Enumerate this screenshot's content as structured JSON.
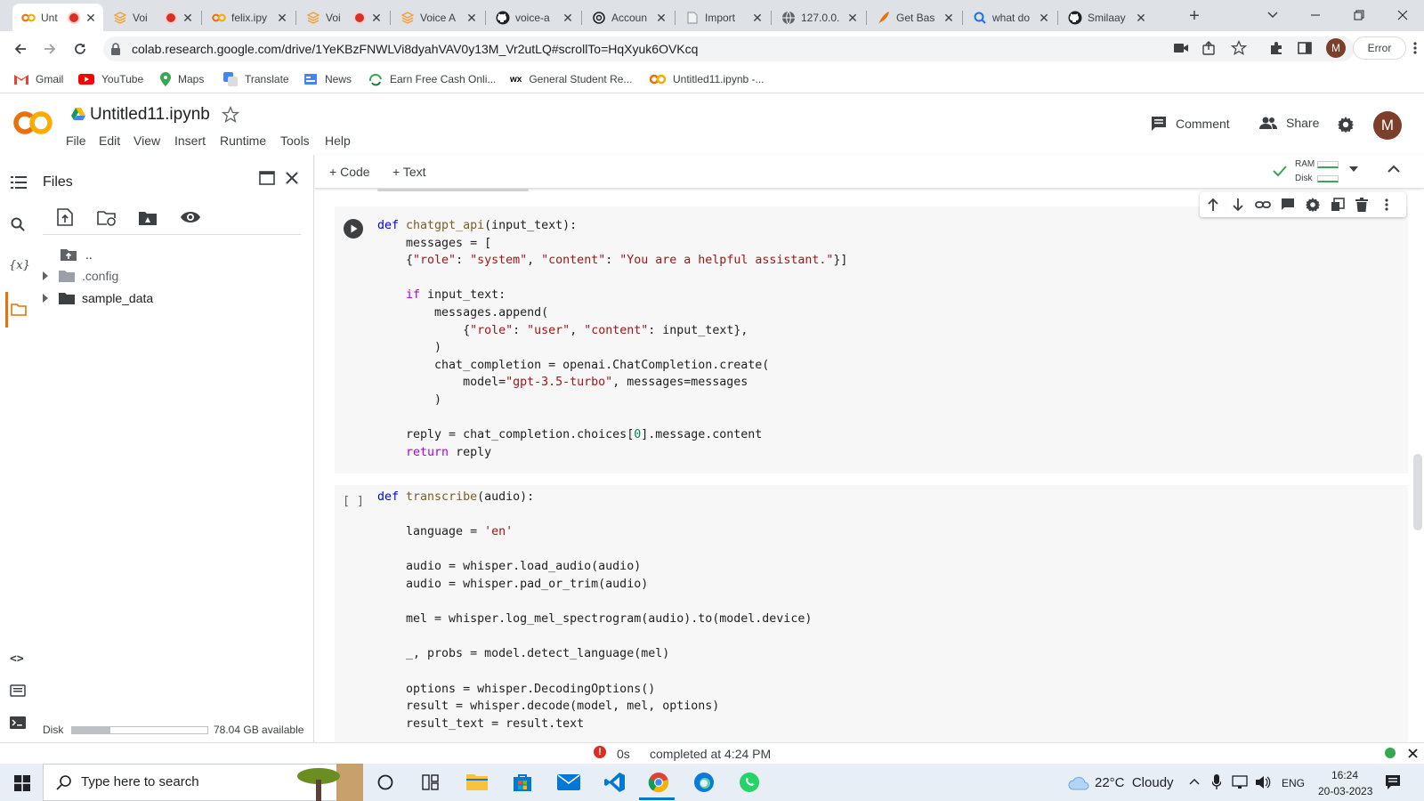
{
  "browser": {
    "tabs": [
      {
        "title": "Unt",
        "recording": true,
        "active": true
      },
      {
        "title": "Voi",
        "recording": true
      },
      {
        "title": "felix.ipy"
      },
      {
        "title": "Voi",
        "recording": true
      },
      {
        "title": "Voice A"
      },
      {
        "title": "voice-a"
      },
      {
        "title": "Accoun"
      },
      {
        "title": "Import"
      },
      {
        "title": "127.0.0."
      },
      {
        "title": "Get Bas"
      },
      {
        "title": "what do"
      },
      {
        "title": "Smilaay"
      }
    ],
    "url": "colab.research.google.com/drive/1YeKBzFNWLVi8dyahVAV0y13M_Vr2utLQ#scrollTo=HqXyuk6OVKcq",
    "error_chip": "Error",
    "profile_initial": "M",
    "bookmarks": [
      "Gmail",
      "YouTube",
      "Maps",
      "Translate",
      "News",
      "Earn Free Cash Onli...",
      "General Student Re...",
      "Untitled11.ipynb -..."
    ]
  },
  "colab": {
    "notebook_title": "Untitled11.ipynb",
    "menu": [
      "File",
      "Edit",
      "View",
      "Insert",
      "Runtime",
      "Tools",
      "Help"
    ],
    "comment_label": "Comment",
    "share_label": "Share",
    "avatar_initial": "M",
    "add_code_label": "Code",
    "add_text_label": "Text",
    "ram_label": "RAM",
    "disk_label": "Disk"
  },
  "files_panel": {
    "title": "Files",
    "tree": [
      {
        "name": "..",
        "kind": "parent"
      },
      {
        "name": ".config",
        "kind": "folder"
      },
      {
        "name": "sample_data",
        "kind": "folder"
      }
    ],
    "disk_label": "Disk",
    "disk_available": "78.04 GB available",
    "disk_used_fraction": 0.28
  },
  "cells": [
    {
      "status": "run",
      "lines": [
        [
          [
            "kw",
            "def "
          ],
          [
            "fn",
            "chatgpt_api"
          ],
          [
            "",
            "(input_text):"
          ]
        ],
        [
          [
            "",
            "    messages = ["
          ]
        ],
        [
          [
            "",
            "    {"
          ],
          [
            "str",
            "\"role\""
          ],
          [
            "",
            ": "
          ],
          [
            "str",
            "\"system\""
          ],
          [
            "",
            ", "
          ],
          [
            "str",
            "\"content\""
          ],
          [
            "",
            ": "
          ],
          [
            "str",
            "\"You are a helpful assistant.\""
          ],
          [
            "",
            "}]"
          ]
        ],
        [
          [
            "",
            ""
          ]
        ],
        [
          [
            "kw2",
            "    if "
          ],
          [
            "",
            "input_text:"
          ]
        ],
        [
          [
            "",
            "        messages.append("
          ]
        ],
        [
          [
            "",
            "            {"
          ],
          [
            "str",
            "\"role\""
          ],
          [
            "",
            ": "
          ],
          [
            "str",
            "\"user\""
          ],
          [
            "",
            ", "
          ],
          [
            "str",
            "\"content\""
          ],
          [
            "",
            ": input_text},"
          ]
        ],
        [
          [
            "",
            "        )"
          ]
        ],
        [
          [
            "",
            "        chat_completion = openai.ChatCompletion.create("
          ]
        ],
        [
          [
            "",
            "            model="
          ],
          [
            "str",
            "\"gpt-3.5-turbo\""
          ],
          [
            "",
            ", messages=messages"
          ]
        ],
        [
          [
            "",
            "        )"
          ]
        ],
        [
          [
            "",
            ""
          ]
        ],
        [
          [
            "",
            "    reply = chat_completion.choices["
          ],
          [
            "num",
            "0"
          ],
          [
            "",
            "].message.content"
          ]
        ],
        [
          [
            "kw2",
            "    return "
          ],
          [
            "",
            "reply"
          ]
        ]
      ]
    },
    {
      "status": "[ ]",
      "lines": [
        [
          [
            "kw",
            "def "
          ],
          [
            "fn",
            "transcribe"
          ],
          [
            "",
            "(audio):"
          ]
        ],
        [
          [
            "",
            ""
          ]
        ],
        [
          [
            "",
            "    language = "
          ],
          [
            "str",
            "'en'"
          ]
        ],
        [
          [
            "",
            ""
          ]
        ],
        [
          [
            "",
            "    audio = whisper.load_audio(audio)"
          ]
        ],
        [
          [
            "",
            "    audio = whisper.pad_or_trim(audio)"
          ]
        ],
        [
          [
            "",
            ""
          ]
        ],
        [
          [
            "",
            "    mel = whisper.log_mel_spectrogram(audio).to(model.device)"
          ]
        ],
        [
          [
            "",
            ""
          ]
        ],
        [
          [
            "",
            "    _, probs = model.detect_language(mel)"
          ]
        ],
        [
          [
            "",
            ""
          ]
        ],
        [
          [
            "",
            "    options = whisper.DecodingOptions()"
          ]
        ],
        [
          [
            "",
            "    result = whisper.decode(model, mel, options)"
          ]
        ],
        [
          [
            "",
            "    result_text = result.text"
          ]
        ]
      ]
    }
  ],
  "statusbar": {
    "elapsed": "0s",
    "completed": "completed at 4:24 PM"
  },
  "taskbar": {
    "search_placeholder": "Type here to search",
    "weather": "22°C  Cloudy",
    "language": "ENG",
    "time": "16:24",
    "date": "20-03-2023"
  }
}
